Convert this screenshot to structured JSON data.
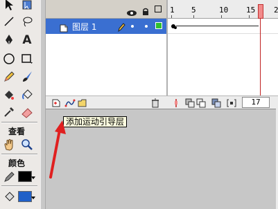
{
  "timeline": {
    "frame_numbers": [
      "1",
      "5",
      "10",
      "15",
      "2"
    ],
    "layer_name": "图层 1",
    "current_frame": "17"
  },
  "tooltip": {
    "text": "添加运动引导层"
  },
  "tools_panel": {
    "text_tool_glyph": "A",
    "view_label": "查看",
    "colors_label": "颜色"
  },
  "colors": {
    "accent_blue": "#3a6fd1",
    "playhead_red": "#c02020",
    "annotation_arrow": "#e02020"
  }
}
